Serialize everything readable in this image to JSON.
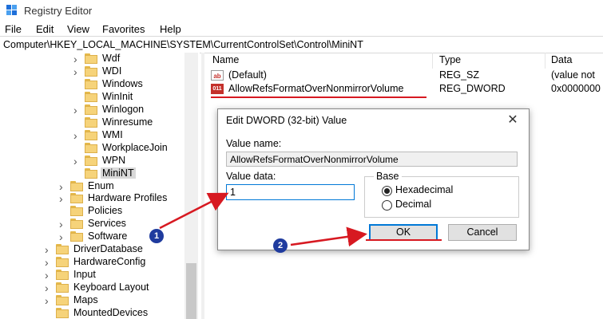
{
  "window": {
    "title": "Registry Editor"
  },
  "menu": [
    "File",
    "Edit",
    "View",
    "Favorites",
    "Help"
  ],
  "address": "Computer\\HKEY_LOCAL_MACHINE\\SYSTEM\\CurrentControlSet\\Control\\MiniNT",
  "tree": [
    {
      "label": "Wdf",
      "expandable": true
    },
    {
      "label": "WDI",
      "expandable": true
    },
    {
      "label": "Windows",
      "expandable": false
    },
    {
      "label": "WinInit",
      "expandable": false
    },
    {
      "label": "Winlogon",
      "expandable": true
    },
    {
      "label": "Winresume",
      "expandable": false
    },
    {
      "label": "WMI",
      "expandable": true
    },
    {
      "label": "WorkplaceJoin",
      "expandable": false
    },
    {
      "label": "WPN",
      "expandable": true
    },
    {
      "label": "MiniNT",
      "expandable": false,
      "selected": true
    },
    {
      "label": "Enum",
      "expandable": true
    },
    {
      "label": "Hardware Profiles",
      "expandable": true
    },
    {
      "label": "Policies",
      "expandable": false
    },
    {
      "label": "Services",
      "expandable": true
    },
    {
      "label": "Software",
      "expandable": true
    },
    {
      "label": "DriverDatabase",
      "expandable": true
    },
    {
      "label": "HardwareConfig",
      "expandable": true
    },
    {
      "label": "Input",
      "expandable": true
    },
    {
      "label": "Keyboard Layout",
      "expandable": true
    },
    {
      "label": "Maps",
      "expandable": true
    },
    {
      "label": "MountedDevices",
      "expandable": false
    }
  ],
  "list": {
    "headers": {
      "name": "Name",
      "type": "Type",
      "data": "Data"
    },
    "rows": [
      {
        "icon": "string-value-icon",
        "icon_text": "ab",
        "name": "(Default)",
        "type": "REG_SZ",
        "data": "(value not"
      },
      {
        "icon": "dword-value-icon",
        "icon_text": "011",
        "name": "AllowRefsFormatOverNonmirrorVolume",
        "type": "REG_DWORD",
        "data": "0x0000000"
      }
    ]
  },
  "dialog": {
    "title": "Edit DWORD (32-bit) Value",
    "value_name_label": "Value name:",
    "value_name": "AllowRefsFormatOverNonmirrorVolume",
    "value_data_label": "Value data:",
    "value_data": "1",
    "base_label": "Base",
    "hex_label": "Hexadecimal",
    "dec_label": "Decimal",
    "base_selected": "Hexadecimal",
    "ok_label": "OK",
    "cancel_label": "Cancel"
  },
  "annotations": {
    "badge1": "1",
    "badge2": "2",
    "arrow_color": "#d71921",
    "badge_color": "#1f3b9e"
  }
}
